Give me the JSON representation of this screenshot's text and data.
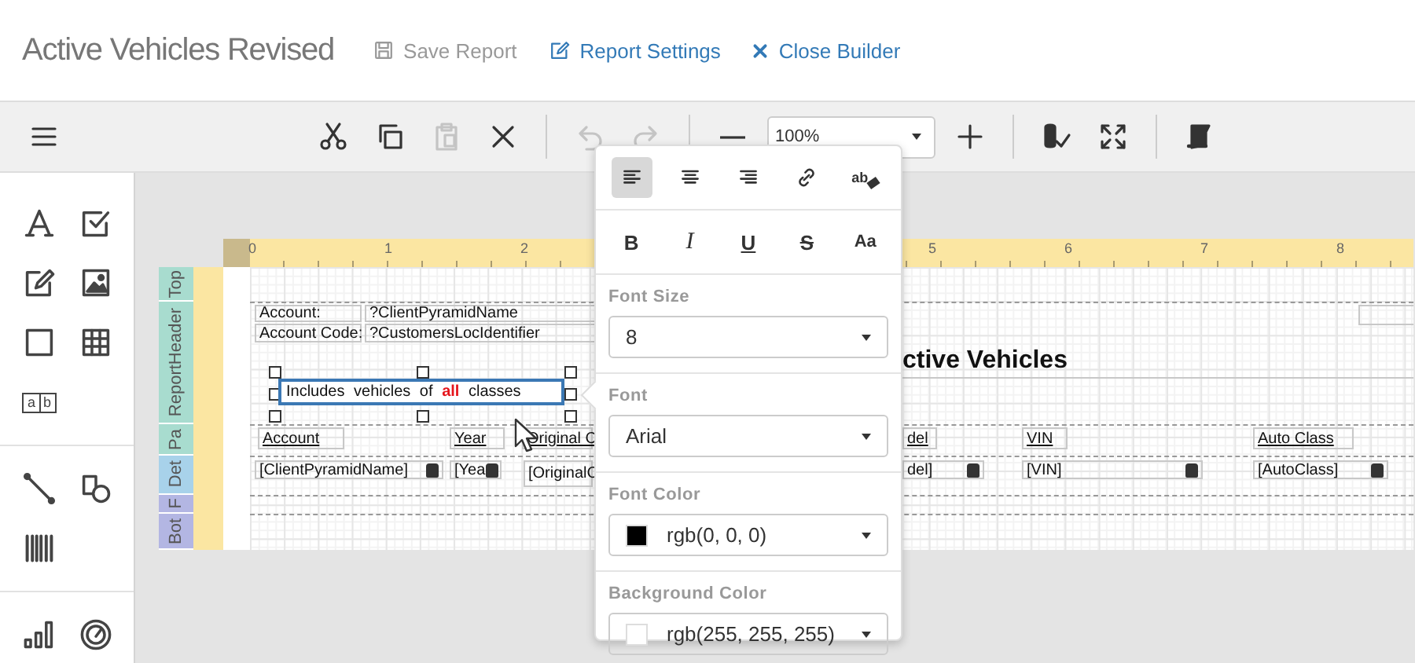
{
  "header": {
    "title": "Active Vehicles Revised",
    "actions": [
      {
        "kind": "save",
        "label": "Save Report",
        "disabled": true
      },
      {
        "kind": "settings",
        "label": "Report Settings",
        "disabled": false
      },
      {
        "kind": "close",
        "label": "Close Builder",
        "disabled": false
      }
    ]
  },
  "toolbar": {
    "groups": [
      [
        {
          "kind": "menu",
          "disabled": false
        }
      ],
      [
        {
          "kind": "cut",
          "disabled": false
        },
        {
          "kind": "copy",
          "disabled": false
        },
        {
          "kind": "paste",
          "disabled": true
        },
        {
          "kind": "delete",
          "disabled": false
        }
      ],
      [
        {
          "kind": "undo",
          "disabled": true
        },
        {
          "kind": "redo",
          "disabled": true
        }
      ],
      [
        {
          "kind": "zoom-out",
          "disabled": false
        },
        {
          "kind": "zoom",
          "value": "100%"
        },
        {
          "kind": "zoom-in",
          "disabled": false
        }
      ],
      [
        {
          "kind": "validate",
          "disabled": false
        },
        {
          "kind": "fullscreen",
          "disabled": false
        }
      ],
      [
        {
          "kind": "script",
          "disabled": false
        }
      ]
    ]
  },
  "toolbox": {
    "groups": [
      [
        {
          "kind": "text"
        },
        {
          "kind": "checkbox"
        },
        {
          "kind": "edit"
        },
        {
          "kind": "image"
        },
        {
          "kind": "rectangle"
        },
        {
          "kind": "table"
        },
        {
          "kind": "richtext",
          "labels": [
            "a",
            "b"
          ]
        }
      ],
      [
        {
          "kind": "line"
        },
        {
          "kind": "shape"
        },
        {
          "kind": "barcode"
        }
      ],
      [
        {
          "kind": "chart"
        },
        {
          "kind": "gauge"
        }
      ]
    ]
  },
  "designer": {
    "ruler": [
      "0",
      "1",
      "2",
      "5",
      "6",
      "7",
      "8"
    ],
    "bands": [
      {
        "label": "Top",
        "color": "#a8dccf"
      },
      {
        "label": "ReportHeader",
        "color": "#a8dccf"
      },
      {
        "label": "Pa",
        "color": "#a8dccf"
      },
      {
        "label": "Det",
        "color": "#a8d2ea"
      },
      {
        "label": "F",
        "color": "#b3b6e3"
      },
      {
        "label": "Bot",
        "color": "#b3b6e3"
      }
    ],
    "items": [
      {
        "kind": "label",
        "text": "Account:"
      },
      {
        "kind": "label",
        "text": "?ClientPyramidName"
      },
      {
        "kind": "label",
        "text": "Account Code:"
      },
      {
        "kind": "label",
        "text": "?CustomersLocIdentifier"
      },
      {
        "kind": "box"
      },
      {
        "kind": "title",
        "text": "**ctive Vehicles**"
      },
      {
        "kind": "rich",
        "text": "Includes vehicles of **all** classes",
        "selected": true
      },
      {
        "kind": "header",
        "text": "Account"
      },
      {
        "kind": "header",
        "text": "Year"
      },
      {
        "kind": "header",
        "text": "Original C"
      },
      {
        "kind": "header",
        "text": "del"
      },
      {
        "kind": "header",
        "text": "VIN"
      },
      {
        "kind": "header",
        "text": "Auto Class"
      },
      {
        "kind": "field",
        "text": "[ClientPyramidName]"
      },
      {
        "kind": "field",
        "text": "[Yea"
      },
      {
        "kind": "label",
        "text": "[OriginalC"
      },
      {
        "kind": "field",
        "text": "del]"
      },
      {
        "kind": "field",
        "text": "[VIN]"
      },
      {
        "kind": "field",
        "text": "[AutoClass]"
      }
    ]
  },
  "popup": {
    "align": [
      {
        "kind": "align-left",
        "selected": true
      },
      {
        "kind": "align-center",
        "selected": false
      },
      {
        "kind": "align-right",
        "selected": false
      }
    ],
    "tools": [
      {
        "kind": "link"
      },
      {
        "kind": "spell",
        "label": "ab"
      }
    ],
    "format": [
      {
        "kind": "bold",
        "label": "B"
      },
      {
        "kind": "italic",
        "label": "I"
      },
      {
        "kind": "underline",
        "label": "U"
      },
      {
        "kind": "strike",
        "label": "S"
      },
      {
        "kind": "case",
        "label": "Aa"
      }
    ],
    "fields": [
      {
        "label": "Font Size",
        "value": "8"
      },
      {
        "label": "Font",
        "value": "Arial"
      },
      {
        "label": "Font Color",
        "value": "rgb(0, 0, 0)",
        "color": "#000000"
      },
      {
        "label": "Background Color",
        "value": "rgb(255, 255, 255)",
        "color": "#ffffff"
      }
    ]
  }
}
